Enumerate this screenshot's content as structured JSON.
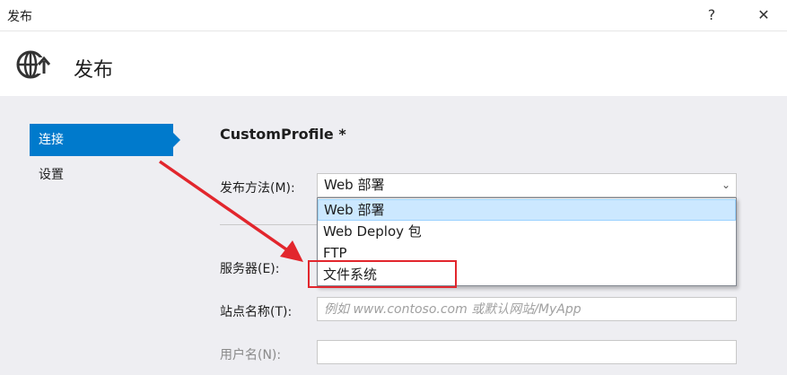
{
  "window": {
    "title": "发布",
    "help_glyph": "?",
    "close_glyph": "✕"
  },
  "header": {
    "icon": "globe-publish-icon",
    "title": "发布"
  },
  "nav": {
    "items": [
      {
        "label": "连接",
        "active": true
      },
      {
        "label": "设置",
        "active": false
      }
    ]
  },
  "profile": {
    "name": "CustomProfile *"
  },
  "form": {
    "method_label": "发布方法(M):",
    "method_value": "Web 部署",
    "method_options": [
      "Web 部署",
      "Web Deploy 包",
      "FTP",
      "文件系统"
    ],
    "server_label": "服务器(E):",
    "site_label": "站点名称(T):",
    "site_placeholder": "例如 www.contoso.com 或默认网站/MyApp",
    "user_label": "用户名(N):",
    "user_value": ""
  },
  "colors": {
    "accent": "#007acc",
    "annotation": "#e2262d",
    "highlight": "#cce8ff"
  }
}
